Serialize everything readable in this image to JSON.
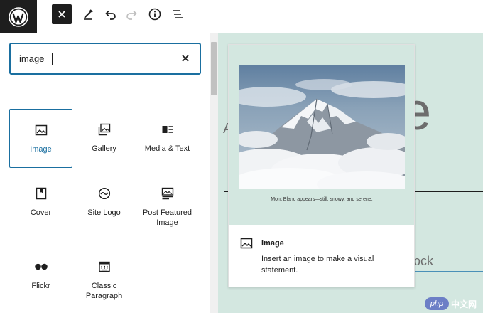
{
  "toolbar": {
    "logo_icon": "wordpress-logo",
    "close_icon": "close-icon",
    "tools": [
      "pencil-icon",
      "undo-icon",
      "redo-icon",
      "info-icon",
      "list-view-icon"
    ]
  },
  "inserter": {
    "search": {
      "value": "image"
    },
    "blocks": [
      {
        "label": "Image",
        "icon": "image-icon",
        "selected": true
      },
      {
        "label": "Gallery",
        "icon": "gallery-icon"
      },
      {
        "label": "Media & Text",
        "icon": "media-text-icon"
      },
      {
        "label": "Cover",
        "icon": "cover-icon"
      },
      {
        "label": "Site Logo",
        "icon": "site-logo-icon"
      },
      {
        "label": "Post Featured Image",
        "icon": "post-featured-image-icon"
      },
      {
        "label": "Flickr",
        "icon": "flickr-icon"
      },
      {
        "label": "Classic Paragraph",
        "icon": "classic-icon"
      }
    ]
  },
  "canvas": {
    "bg_letter": "e",
    "bg_letter_a": "A",
    "bg_ock": "ock"
  },
  "preview": {
    "caption": "Mont Blanc appears—still, snowy, and serene.",
    "title": "Image",
    "description": "Insert an image to make a visual statement."
  },
  "watermark": {
    "logo": "php",
    "text": "中文网"
  },
  "colors": {
    "accent": "#1a6fa0",
    "canvas_bg": "#d3e7e0",
    "dark": "#1e1e1e"
  }
}
